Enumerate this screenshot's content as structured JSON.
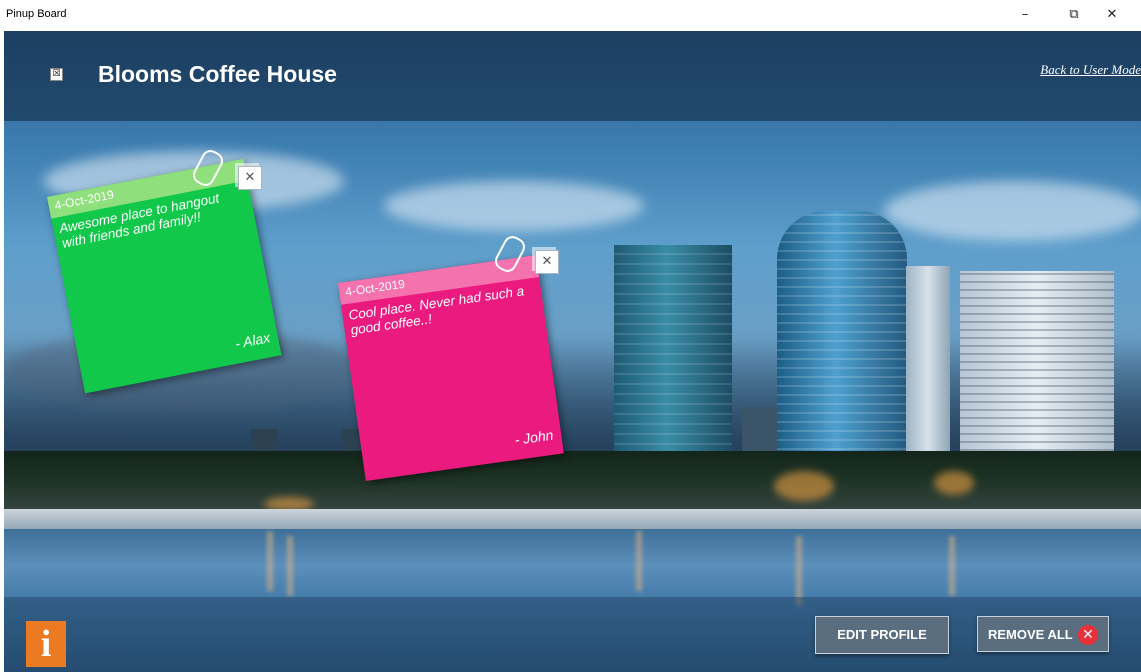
{
  "window": {
    "title": "Pinup Board",
    "minimize_icon": "–",
    "maximize_icon": "⧉",
    "close_icon": "✕"
  },
  "header": {
    "close_icon": "☒",
    "title": "Blooms Coffee House",
    "back_link": "Back to User Mode"
  },
  "notes": [
    {
      "date": "4-Oct-2019",
      "text": "Awesome place to hangout with friends and family!!",
      "author": "- Alax",
      "color": "#12c84a",
      "header_color": "#8fe07c",
      "close_icon": "✕"
    },
    {
      "date": "4-Oct-2019",
      "text": "Cool place. Never had such a good coffee..!",
      "author": "- John",
      "color": "#ea1a7e",
      "header_color": "#f472ae",
      "close_icon": "✕"
    }
  ],
  "footer": {
    "info_icon": "i",
    "info_color": "#ec7a22",
    "edit_profile_label": "EDIT PROFILE",
    "remove_all_label": "REMOVE ALL",
    "remove_all_icon": "✕",
    "remove_icon_color": "#e8303a"
  }
}
